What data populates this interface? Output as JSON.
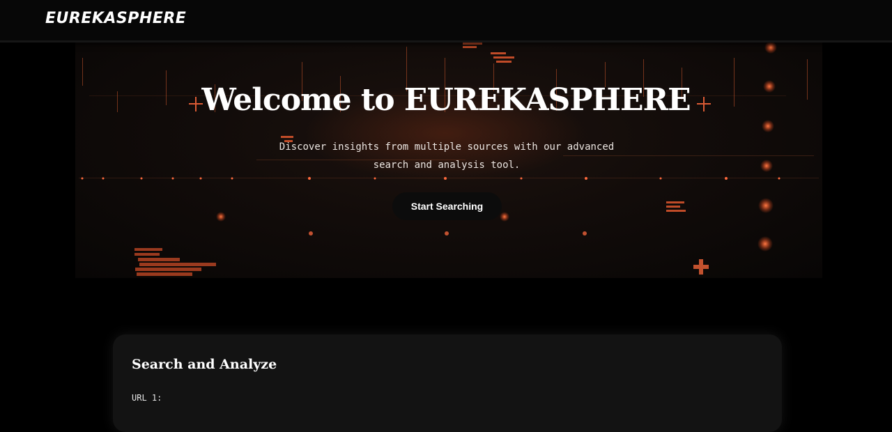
{
  "navbar": {
    "brand": "EUREKASPHERE"
  },
  "hero": {
    "title": "Welcome to EUREKASPHERE",
    "subtitle": "Discover insights from multiple sources with our advanced search and analysis tool.",
    "cta_label": "Start Searching"
  },
  "search_card": {
    "title": "Search and Analyze",
    "url1_label": "URL 1:"
  },
  "theme": {
    "background": "#000000",
    "accent": "#ff6a3d",
    "card_bg": "#131313",
    "text": "#ffffff"
  }
}
